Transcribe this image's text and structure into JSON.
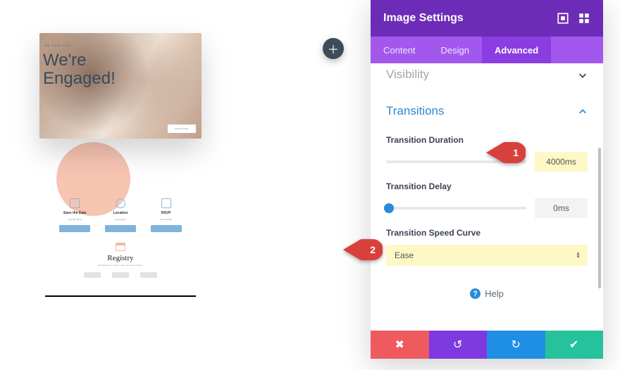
{
  "preview": {
    "subhead": "WE SAID YES",
    "title_line1": "We're",
    "title_line2": "Engaged!",
    "button_label": "READ STORY",
    "cols": [
      {
        "label": "Save the Date",
        "sub": "July 4th, 2019"
      },
      {
        "label": "Location",
        "sub": "Los Angeles"
      },
      {
        "label": "RSVP",
        "sub": "Don't be late"
      }
    ],
    "registry_title": "Registry",
    "registry_sub": "Everything we need to make our house a home"
  },
  "panel": {
    "title": "Image Settings",
    "tabs": {
      "content": "Content",
      "design": "Design",
      "advanced": "Advanced",
      "active": "advanced"
    },
    "collapsed_section": "Visibility",
    "section_title": "Transitions",
    "transition_duration_label": "Transition Duration",
    "transition_duration_value": "4000ms",
    "transition_delay_label": "Transition Delay",
    "transition_delay_value": "0ms",
    "speed_curve_label": "Transition Speed Curve",
    "speed_curve_value": "Ease",
    "help_label": "Help"
  },
  "markers": {
    "one": "1",
    "two": "2"
  },
  "colors": {
    "marker": "#d8403b"
  }
}
